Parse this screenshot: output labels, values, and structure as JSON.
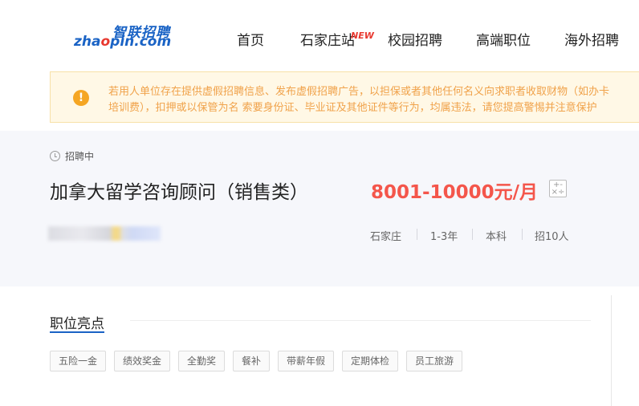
{
  "header": {
    "logo_cn": "智联招聘",
    "logo_en_a": "zha",
    "logo_en_b": "pin.com",
    "nav": {
      "home": "首页",
      "city": "石家庄站",
      "city_badge": "NEW",
      "campus": "校园招聘",
      "senior": "高端职位",
      "overseas": "海外招聘"
    }
  },
  "alert": {
    "icon": "exclamation-icon",
    "line1": "若用人单位存在提供虚假招聘信息、发布虚假招聘广告，以担保或者其他任何名义向求职者收取财物（如办卡",
    "line2": "培训费），扣押或以保管为名 索要身份证、毕业证及其他证件等行为，均属违法，请您提高警惕并注意保护"
  },
  "job": {
    "status": "招聘中",
    "title": "加拿大留学咨询顾问（销售类）",
    "salary": "8001-10000元/月",
    "calc_icon": "calculator-icon",
    "calc_symbols": "+-\n×÷",
    "location": "石家庄",
    "experience": "1-3年",
    "education": "本科",
    "headcount": "招10人"
  },
  "highlights": {
    "title": "职位亮点",
    "tags": [
      "五险一金",
      "绩效奖金",
      "全勤奖",
      "餐补",
      "带薪年假",
      "定期体检",
      "员工旅游"
    ]
  }
}
